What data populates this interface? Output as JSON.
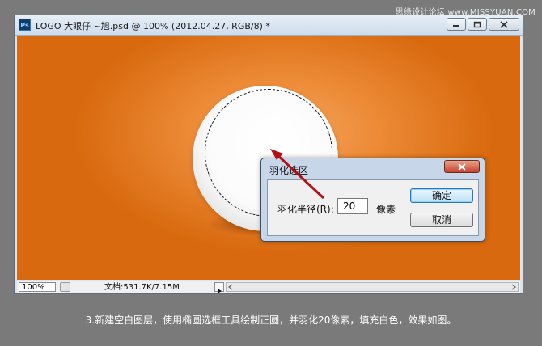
{
  "watermark": "思缘设计论坛 www.MISSYUAN.COM",
  "window": {
    "app_icon": "Ps",
    "title": "LOGO 大眼仔 ~旭.psd @ 100% (2012.04.27, RGB/8) *",
    "controls": [
      "minimize-icon",
      "restore-icon",
      "close-icon"
    ]
  },
  "statusbar": {
    "zoom": "100%",
    "doc_info": "文档:531.7K/7.15M"
  },
  "dialog": {
    "title": "羽化选区",
    "radius_label": "羽化半径(R):",
    "radius_value": "20",
    "unit": "像素",
    "ok_label": "确定",
    "cancel_label": "取消"
  },
  "caption": "3.新建空白图层，使用椭圆选框工具绘制正圆，并羽化20像素，填充白色，效果如图。",
  "colors": {
    "canvas_orange": "#ec8a36",
    "annotation_arrow": "#b40f14"
  }
}
